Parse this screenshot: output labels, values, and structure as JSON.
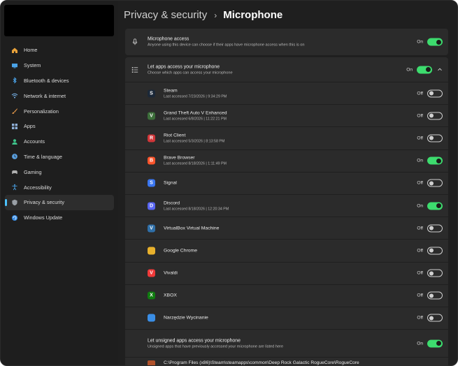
{
  "breadcrumb": {
    "parent": "Privacy & security",
    "separator": "›",
    "current": "Microphone"
  },
  "sidebar": {
    "items": [
      {
        "label": "Home",
        "icon": "home-icon",
        "color": "#e8a23a"
      },
      {
        "label": "System",
        "icon": "system-icon",
        "color": "#4aa3e8"
      },
      {
        "label": "Bluetooth & devices",
        "icon": "bluetooth-icon",
        "color": "#4aa3e8"
      },
      {
        "label": "Network & internet",
        "icon": "network-icon",
        "color": "#7ab8f0"
      },
      {
        "label": "Personalization",
        "icon": "brush-icon",
        "color": "#e89a4a"
      },
      {
        "label": "Apps",
        "icon": "apps-icon",
        "color": "#8fb0d8"
      },
      {
        "label": "Accounts",
        "icon": "account-icon",
        "color": "#3ec28a"
      },
      {
        "label": "Time & language",
        "icon": "clock-icon",
        "color": "#5aa0e0"
      },
      {
        "label": "Gaming",
        "icon": "gamepad-icon",
        "color": "#b0b0b0"
      },
      {
        "label": "Accessibility",
        "icon": "accessibility-icon",
        "color": "#4aa3e8"
      },
      {
        "label": "Privacy & security",
        "icon": "shield-icon",
        "color": "#9aa0a6",
        "active": true
      },
      {
        "label": "Windows Update",
        "icon": "update-icon",
        "color": "#3a8ee6"
      }
    ]
  },
  "access": {
    "title": "Microphone access",
    "description": "Anyone using this device can choose if their apps have microphone access when this is on",
    "state_label": "On",
    "on": true
  },
  "apps_section": {
    "title": "Let apps access your microphone",
    "description": "Choose which apps can access your microphone",
    "state_label": "On",
    "on": true
  },
  "apps": [
    {
      "name": "Steam",
      "meta": "Last accessed 7/23/2026 | 9:34:29 PM",
      "state_label": "Off",
      "on": false,
      "icon": "steam-icon",
      "color": "#1b2838",
      "glyph": "S"
    },
    {
      "name": "Grand Theft Auto V Enhanced",
      "meta": "Last accessed 6/8/2026 | 11:22:21 PM",
      "state_label": "Off",
      "on": false,
      "icon": "gta-icon",
      "color": "#3c6e3a",
      "glyph": "V"
    },
    {
      "name": "Riot Client",
      "meta": "Last accessed 5/3/2026 | 8:13:58 PM",
      "state_label": "Off",
      "on": false,
      "icon": "riot-icon",
      "color": "#d13639",
      "glyph": "R"
    },
    {
      "name": "Brave Browser",
      "meta": "Last accessed 8/18/2026 | 1:11:49 PM",
      "state_label": "On",
      "on": true,
      "icon": "brave-icon",
      "color": "#fb542b",
      "glyph": "B"
    },
    {
      "name": "Signal",
      "meta": "",
      "state_label": "Off",
      "on": false,
      "icon": "signal-icon",
      "color": "#3a76f0",
      "glyph": "S"
    },
    {
      "name": "Discord",
      "meta": "Last accessed 8/18/2026 | 12:20:34 PM",
      "state_label": "On",
      "on": true,
      "icon": "discord-icon",
      "color": "#5865f2",
      "glyph": "D"
    },
    {
      "name": "VirtualBox Virtual Machine",
      "meta": "",
      "state_label": "Off",
      "on": false,
      "icon": "virtualbox-icon",
      "color": "#2f6fa8",
      "glyph": "V"
    },
    {
      "name": "Google Chrome",
      "meta": "",
      "state_label": "Off",
      "on": false,
      "icon": "chrome-icon",
      "color": "#e8b12c",
      "glyph": ""
    },
    {
      "name": "Vivaldi",
      "meta": "",
      "state_label": "Off",
      "on": false,
      "icon": "vivaldi-icon",
      "color": "#ef3939",
      "glyph": "V"
    },
    {
      "name": "XBOX",
      "meta": "",
      "state_label": "Off",
      "on": false,
      "icon": "xbox-icon",
      "color": "#107c10",
      "glyph": "X"
    },
    {
      "name": "Narzędzie Wycinanie",
      "meta": "",
      "state_label": "Off",
      "on": false,
      "icon": "snipping-tool-icon",
      "color": "#3a8ee6",
      "glyph": ""
    }
  ],
  "unsigned": {
    "title": "Let unsigned apps access your microphone",
    "description": "Unsigned apps that have previously accessed your microphone are listed here",
    "state_label": "On",
    "on": true
  },
  "unsigned_apps": [
    {
      "path": "C:\\Program Files (x86)\\Steam\\steamapps\\common\\Deep Rock Galactic RogueCore\\RogueCore"
    }
  ]
}
